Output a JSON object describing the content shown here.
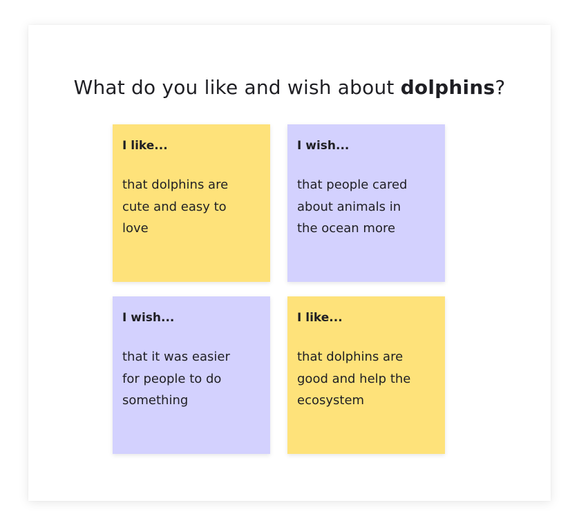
{
  "title": {
    "prefix": "What do you like and wish about ",
    "topic": "dolphins",
    "suffix": "?"
  },
  "notes": [
    {
      "color": "#fee27a",
      "heading": "I like...",
      "text": "that dolphins are cute and easy to love"
    },
    {
      "color": "#d3d1fe",
      "heading": "I wish...",
      "text": "that people cared about animals in the ocean more"
    },
    {
      "color": "#d3d1fe",
      "heading": "I wish...",
      "text": "that it was easier for people to do something"
    },
    {
      "color": "#fee27a",
      "heading": "I like...",
      "text": "that dolphins are good and help the ecosystem"
    }
  ]
}
